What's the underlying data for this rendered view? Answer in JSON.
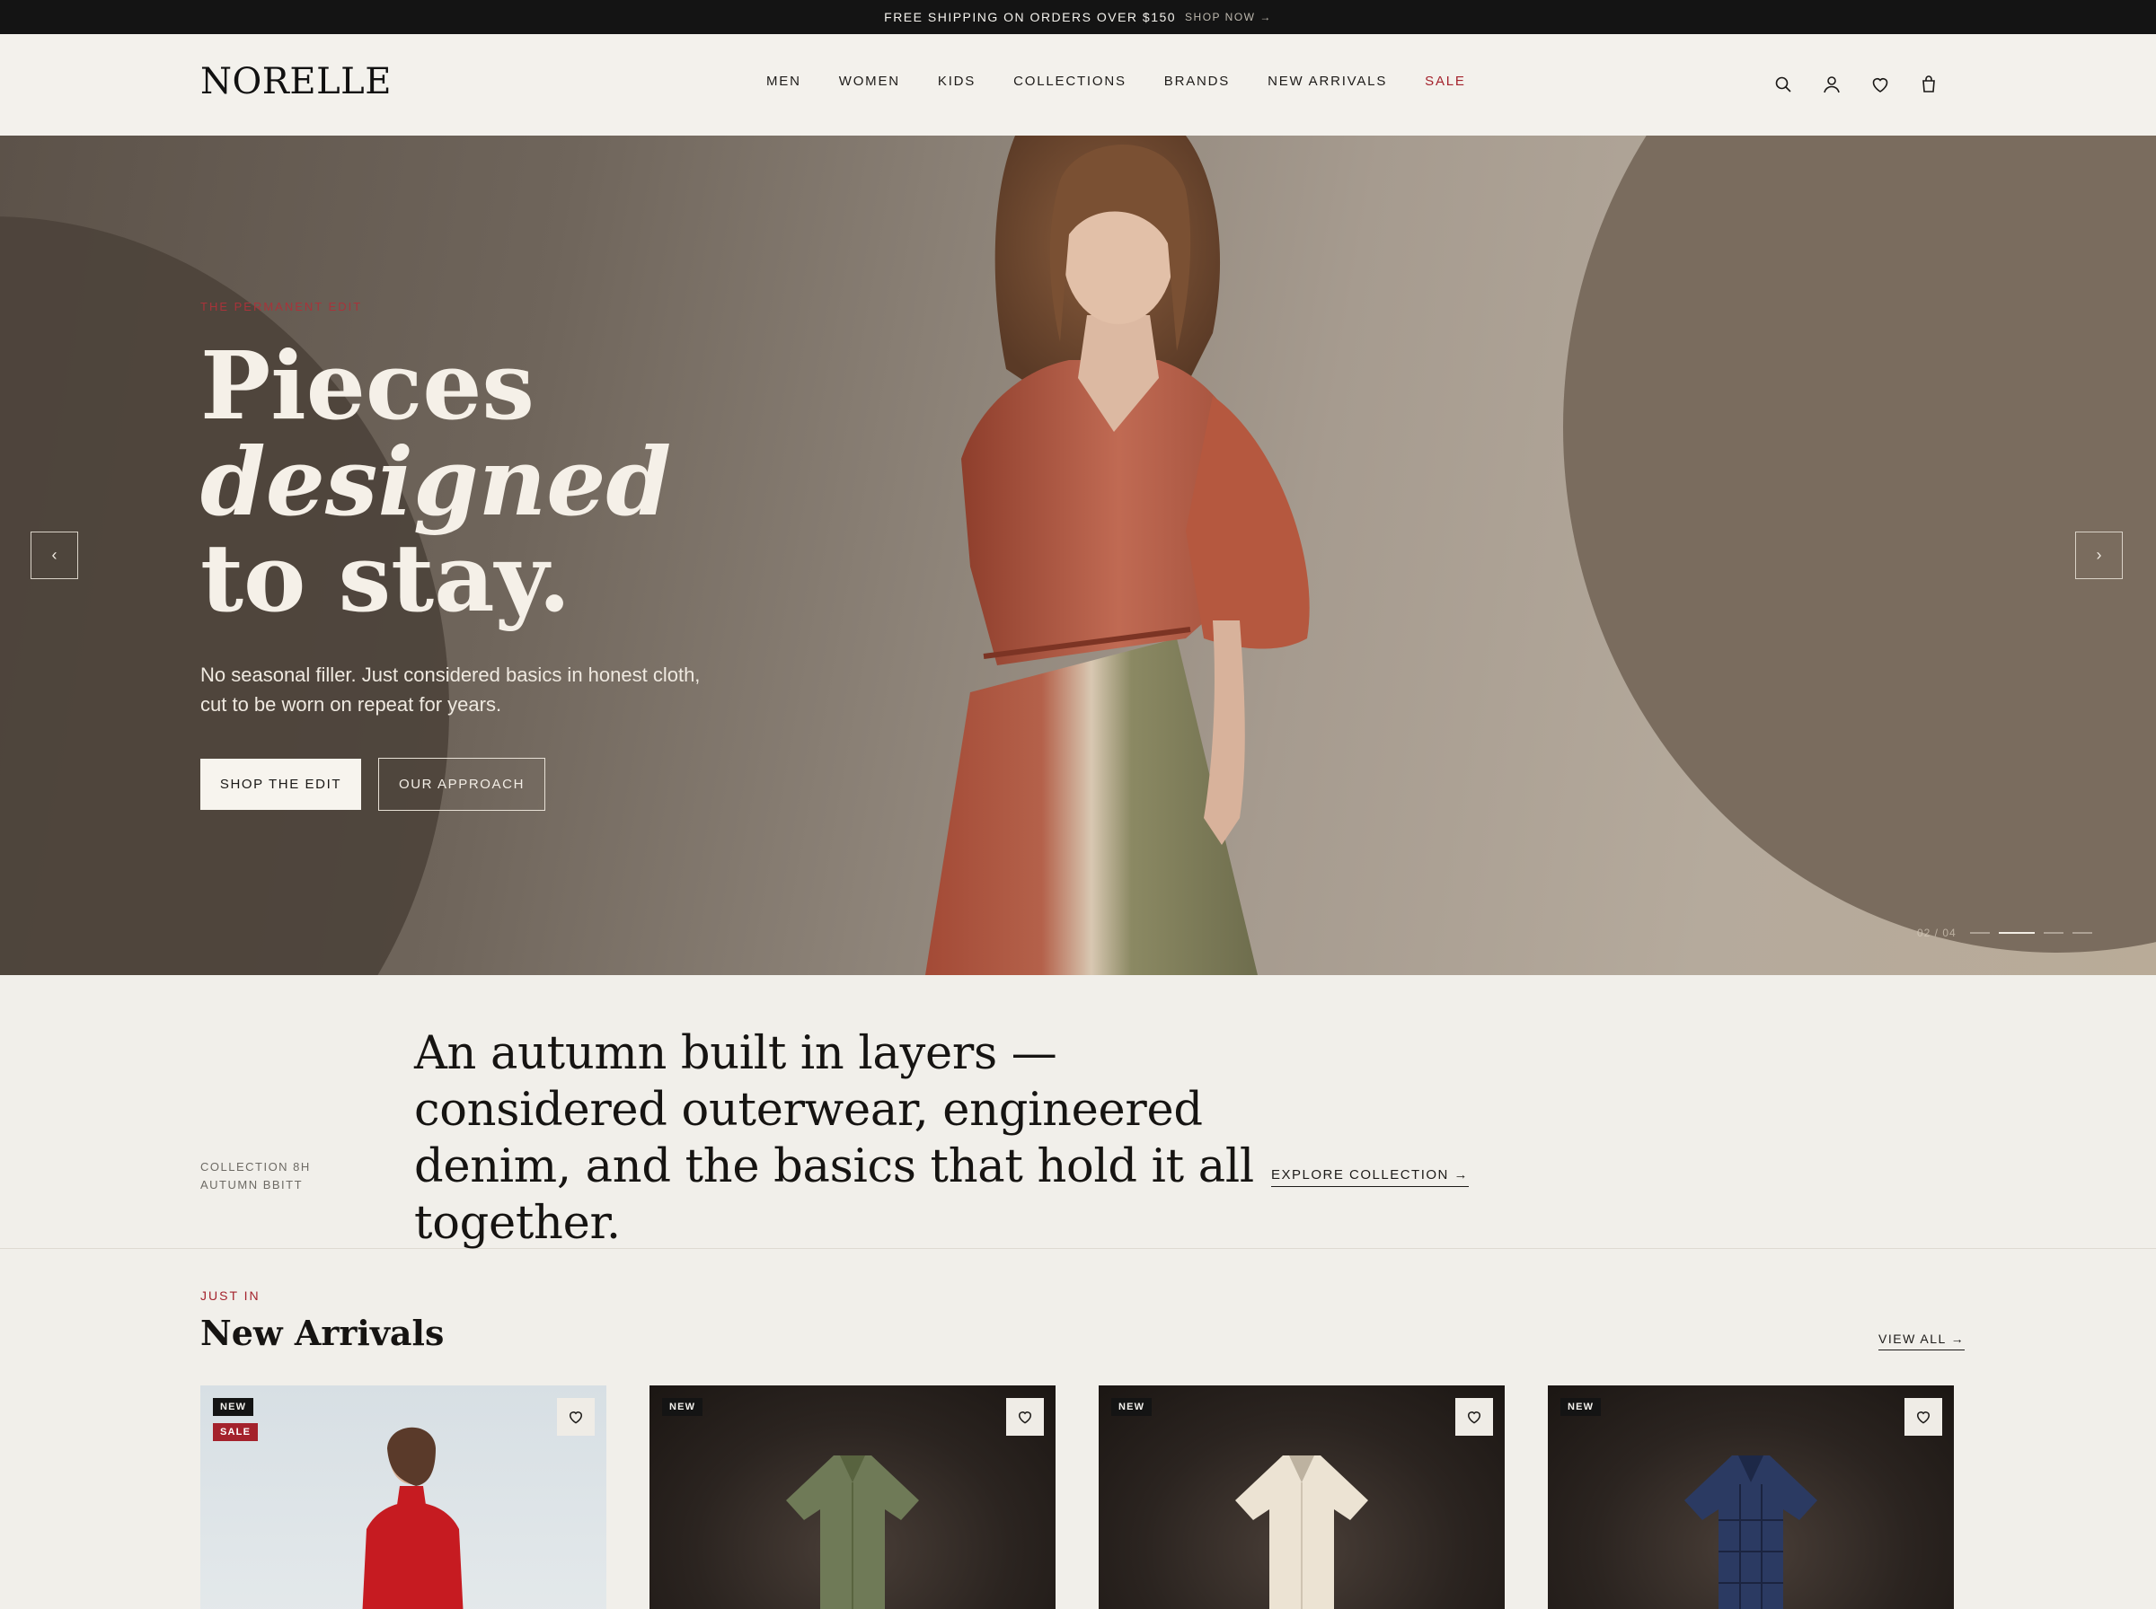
{
  "announcement": {
    "message": "FREE SHIPPING ON ORDERS OVER $150",
    "cta": "SHOP NOW →"
  },
  "header": {
    "logo": "NORELLE",
    "nav": [
      "MEN",
      "WOMEN",
      "KIDS",
      "COLLECTIONS",
      "BRANDS",
      "NEW ARRIVALS",
      "SALE"
    ],
    "icons": [
      "search-icon",
      "account-icon",
      "heart-icon",
      "bag-icon"
    ]
  },
  "hero": {
    "eyebrow": "THE PERMANENT EDIT",
    "headline_line1": "Pieces",
    "headline_line2": "designed",
    "headline_line3": "to stay.",
    "subcopy": "No seasonal filler. Just considered basics in honest cloth, cut to be worn on repeat for years.",
    "primary_cta": "SHOP THE EDIT",
    "secondary_cta": "OUR APPROACH",
    "prev_label": "‹",
    "next_label": "›",
    "counter": "02 / 04",
    "active_slide": 2,
    "slide_count": 4
  },
  "intro": {
    "meta_line1": "COLLECTION 8H",
    "meta_line2": "AUTUMN BBITT",
    "text": "An autumn built in layers — considered outerwear, engineered denim, and the basics that hold it all together.",
    "cta": "EXPLORE COLLECTION →"
  },
  "arrivals": {
    "eyebrow": "JUST IN",
    "title": "New Arrivals",
    "view_all": "VIEW ALL →",
    "badge_new": "NEW",
    "badge_sale": "SALE",
    "products": [
      {
        "badges": [
          "NEW",
          "SALE"
        ],
        "color": "#c4161c"
      },
      {
        "badges": [
          "NEW"
        ],
        "color": "#6f7a57"
      },
      {
        "badges": [
          "NEW"
        ],
        "color": "#ece3d3"
      },
      {
        "badges": [
          "NEW"
        ],
        "color": "#2b3a62"
      }
    ]
  },
  "colors": {
    "accent_red": "#a4222c",
    "dark": "#141414",
    "background": "#f1efea"
  }
}
